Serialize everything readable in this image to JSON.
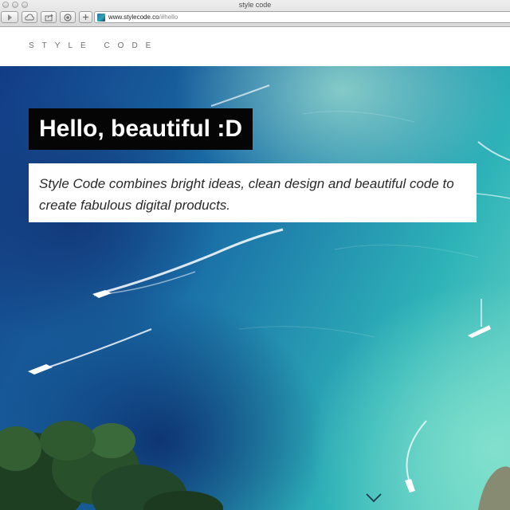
{
  "browser": {
    "window_title": "style code",
    "url_host": "www.stylecode.co",
    "url_path": "/#hello",
    "toolbar_icons": [
      "back-icon",
      "cloud-icon",
      "share-icon",
      "reader-icon",
      "new-tab-icon"
    ]
  },
  "site": {
    "logo": "STYLE CODE"
  },
  "hero": {
    "headline": "Hello, beautiful :D",
    "tagline": "Style Code combines bright ideas, clean design and beautiful code to create fabulous digital products.",
    "scroll_icon": "chevron-down-icon"
  },
  "colors": {
    "headline_bg": "#050505",
    "headline_text": "#ffffff",
    "tagline_bg": "#ffffff",
    "logo_text": "#6d6d6d",
    "sea_deep": "#123c86",
    "sea_light": "#6fd7c6"
  }
}
